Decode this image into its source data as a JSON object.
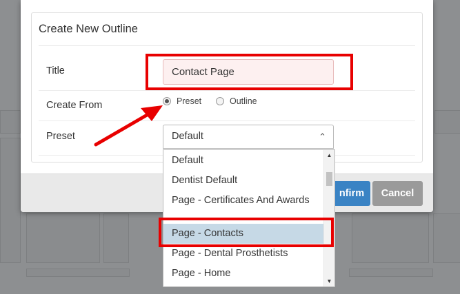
{
  "modal": {
    "title": "Create New Outline",
    "fields": {
      "title_label": "Title",
      "title_value": "Contact Page",
      "create_from_label": "Create From",
      "radio_preset": "Preset",
      "radio_outline": "Outline",
      "selected_radio": "Preset",
      "preset_label": "Preset",
      "preset_value": "Default",
      "preset_chevron_icon": "chevron-up-icon"
    },
    "footer": {
      "confirm_label": "nfirm",
      "cancel_label": "Cancel"
    }
  },
  "dropdown": {
    "options": [
      "Default",
      "Dentist Default",
      "Page - Certificates And Awards",
      "Page - Contacts",
      "Page - Dental Prosthetists",
      "Page - Home"
    ],
    "highlighted": "Page - Contacts",
    "scroll_up_icon": "triangle-up-icon",
    "scroll_down_icon": "triangle-down-icon"
  },
  "colors": {
    "annotation_red": "#e80000",
    "confirm_blue": "#3a83c4",
    "cancel_gray": "#9a9a9a",
    "highlight_blue": "#c6d9e6"
  }
}
